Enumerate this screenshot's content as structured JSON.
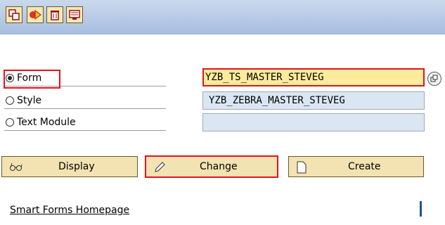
{
  "toolbar": {
    "buttons": [
      {
        "name": "copy-icon"
      },
      {
        "name": "rename-icon"
      },
      {
        "name": "delete-icon"
      },
      {
        "name": "test-icon"
      }
    ]
  },
  "options": [
    {
      "label": "Form",
      "checked": true
    },
    {
      "label": "Style",
      "checked": false
    },
    {
      "label": "Text Module",
      "checked": false
    }
  ],
  "fields": {
    "form_value": "YZB_TS_MASTER_STEVEG",
    "style_value": "YZB_ZEBRA_MASTER_STEVEG",
    "text_module_value": ""
  },
  "actions": {
    "display_label": "Display",
    "change_label": "Change",
    "create_label": "Create"
  },
  "link": {
    "label": "Smart Forms Homepage"
  },
  "colors": {
    "highlight": "#e1141e",
    "toolbar": "#a9bfe0",
    "button": "#f3e2b2"
  }
}
